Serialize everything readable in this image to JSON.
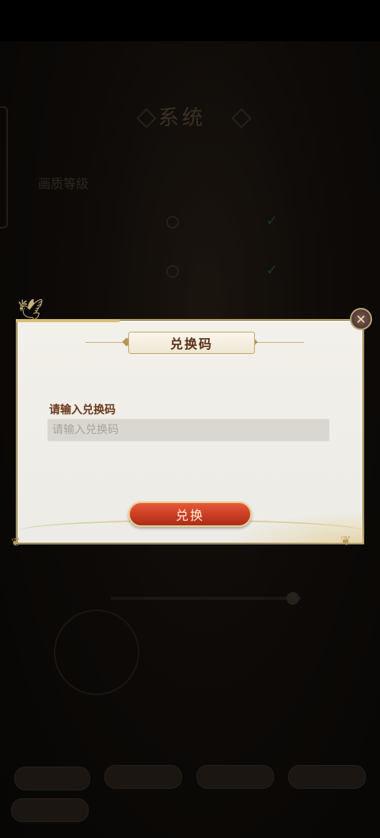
{
  "modal": {
    "title": "兑换码",
    "field_label": "请输入兑换码",
    "input_placeholder": "请输入兑换码",
    "input_value": "",
    "redeem_label": "兑换",
    "close_icon": "close-icon"
  },
  "background": {
    "title": "系统",
    "section": "画质等级"
  },
  "colors": {
    "accent": "#c83a22",
    "gold": "#c9b27a",
    "title_text": "#5a3118"
  }
}
